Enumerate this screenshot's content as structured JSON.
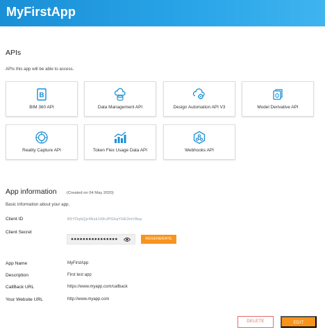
{
  "header": {
    "title": "MyFirstApp"
  },
  "apis": {
    "title": "APIs",
    "subtitle": "APIs this app will be able to access.",
    "cards": [
      {
        "label": "BIM 360 API",
        "icon": "bim360-icon"
      },
      {
        "label": "Data Management API",
        "icon": "cloud-data-icon"
      },
      {
        "label": "Design Automation API V3",
        "icon": "cloud-gear-icon"
      },
      {
        "label": "Model Derivative API",
        "icon": "model-derivative-icon"
      },
      {
        "label": "Reality Capture API",
        "icon": "reality-capture-icon"
      },
      {
        "label": "Token Flex Usage Data API",
        "icon": "chart-icon"
      },
      {
        "label": "Webhooks API",
        "icon": "webhook-icon"
      }
    ]
  },
  "app_info": {
    "title": "App information",
    "created": "(Created on 04 May 2020)",
    "subtitle": "Basic information about your app.",
    "client_id_label": "Client ID",
    "client_id_value": "B5YDqbQjr4Nsk1I6hJPGhqYHE3mV8ep",
    "client_secret_label": "Client Secret",
    "client_secret_value": "●●●●●●●●●●●●●●●●",
    "regenerate_label": "REGENERATE",
    "app_name_label": "App Name",
    "app_name_value": "MyFirstApp",
    "description_label": "Description",
    "description_value": "First test app",
    "callback_label": "CallBack URL",
    "callback_value": "https://www.myapp.com/callback",
    "website_label": "Your Website URL",
    "website_value": "http://www.myapp.com"
  },
  "actions": {
    "delete_label": "DELETE",
    "edit_label": "EDIT"
  },
  "colors": {
    "header": "#1a8fd6",
    "accent": "#f7941d",
    "danger": "#e26b6b",
    "icon": "#1a8fd6"
  }
}
